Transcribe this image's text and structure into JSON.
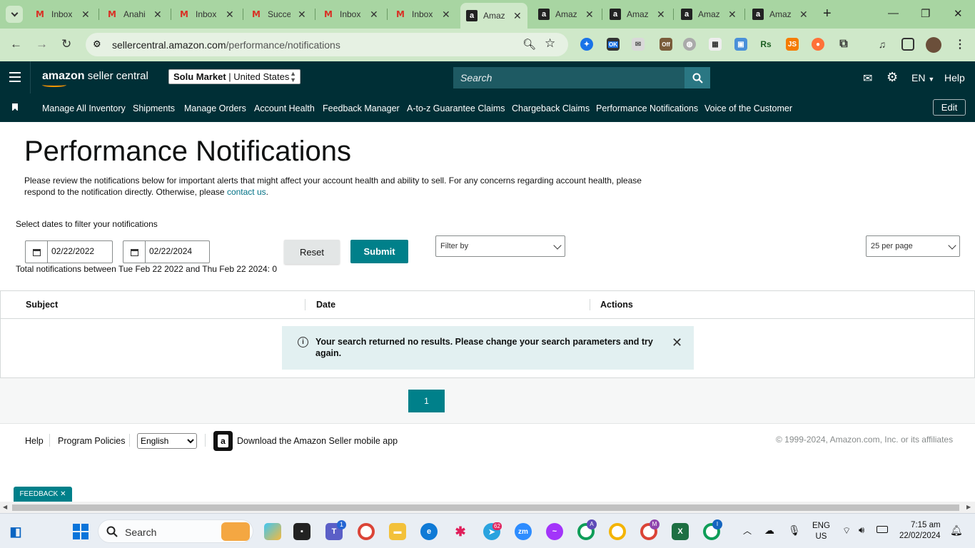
{
  "browser": {
    "tabs": [
      {
        "title": "Inbox",
        "icon": "gmail-icon"
      },
      {
        "title": "Anahi",
        "icon": "gmail-icon"
      },
      {
        "title": "Inbox",
        "icon": "gmail-icon"
      },
      {
        "title": "Succe",
        "icon": "gmail-icon"
      },
      {
        "title": "Inbox",
        "icon": "gmail-icon"
      },
      {
        "title": "Inbox",
        "icon": "gmail-icon"
      },
      {
        "title": "Amaz",
        "icon": "amazon-icon",
        "active": true
      },
      {
        "title": "Amaz",
        "icon": "amazon-icon"
      },
      {
        "title": "Amaz",
        "icon": "amazon-icon"
      },
      {
        "title": "Amaz",
        "icon": "amazon-icon"
      },
      {
        "title": "Amaz",
        "icon": "amazon-icon"
      }
    ],
    "url_host": "sellercentral.amazon.com",
    "url_path": "/performance/notifications",
    "extensions": {
      "ok_badge": "OK",
      "off_badge": "Off",
      "rs": "Rs",
      "js": "JS"
    }
  },
  "header": {
    "logo_strong": "amazon",
    "logo_rest": " seller central",
    "store": "Solu Market",
    "region": "United States",
    "search_placeholder": "Search",
    "language": "EN",
    "help": "Help"
  },
  "nav": {
    "items": [
      "Manage All Inventory",
      "Shipments",
      "Manage Orders",
      "Account Health",
      "Feedback Manager",
      "A-to-z Guarantee Claims",
      "Chargeback Claims",
      "Performance Notifications",
      "Voice of the Customer"
    ],
    "edit": "Edit"
  },
  "page": {
    "title": "Performance Notifications",
    "description": "Please review the notifications below for important alerts that might affect your account health and ability to sell. For any concerns regarding account health, please respond to the notification directly. Otherwise, please ",
    "contact_link": "contact us",
    "description_end": ".",
    "filter_label": "Select dates to filter your notifications",
    "start_date": "02/22/2022",
    "end_date": "02/22/2024",
    "reset": "Reset",
    "submit": "Submit",
    "filter_by": "Filter by",
    "per_page": "25 per page",
    "total_text": "Total notifications between Tue Feb 22 2022 and Thu Feb 22 2024: 0",
    "columns": [
      "Subject",
      "Date",
      "Actions"
    ],
    "no_results": "Your search returned no results. Please change your search parameters and try again.",
    "current_page": "1"
  },
  "footer": {
    "help": "Help",
    "policies": "Program Policies",
    "language": "English",
    "app_text": "Download the Amazon Seller mobile app",
    "copyright": "© 1999-2024, Amazon.com, Inc. or its affiliates",
    "feedback": "FEEDBACK"
  },
  "taskbar": {
    "search": "Search",
    "lang_top": "ENG",
    "lang_bottom": "US",
    "time": "7:15 am",
    "date": "22/02/2024",
    "badges": {
      "teams": "1",
      "telegram": "62",
      "chrome_a": "A",
      "chrome_m": "M",
      "chrome_i": "I"
    }
  },
  "colors": {
    "browser_frame": "#a8d5a2",
    "header_bg": "#002f36",
    "accent": "#00808a",
    "link": "#007185"
  }
}
